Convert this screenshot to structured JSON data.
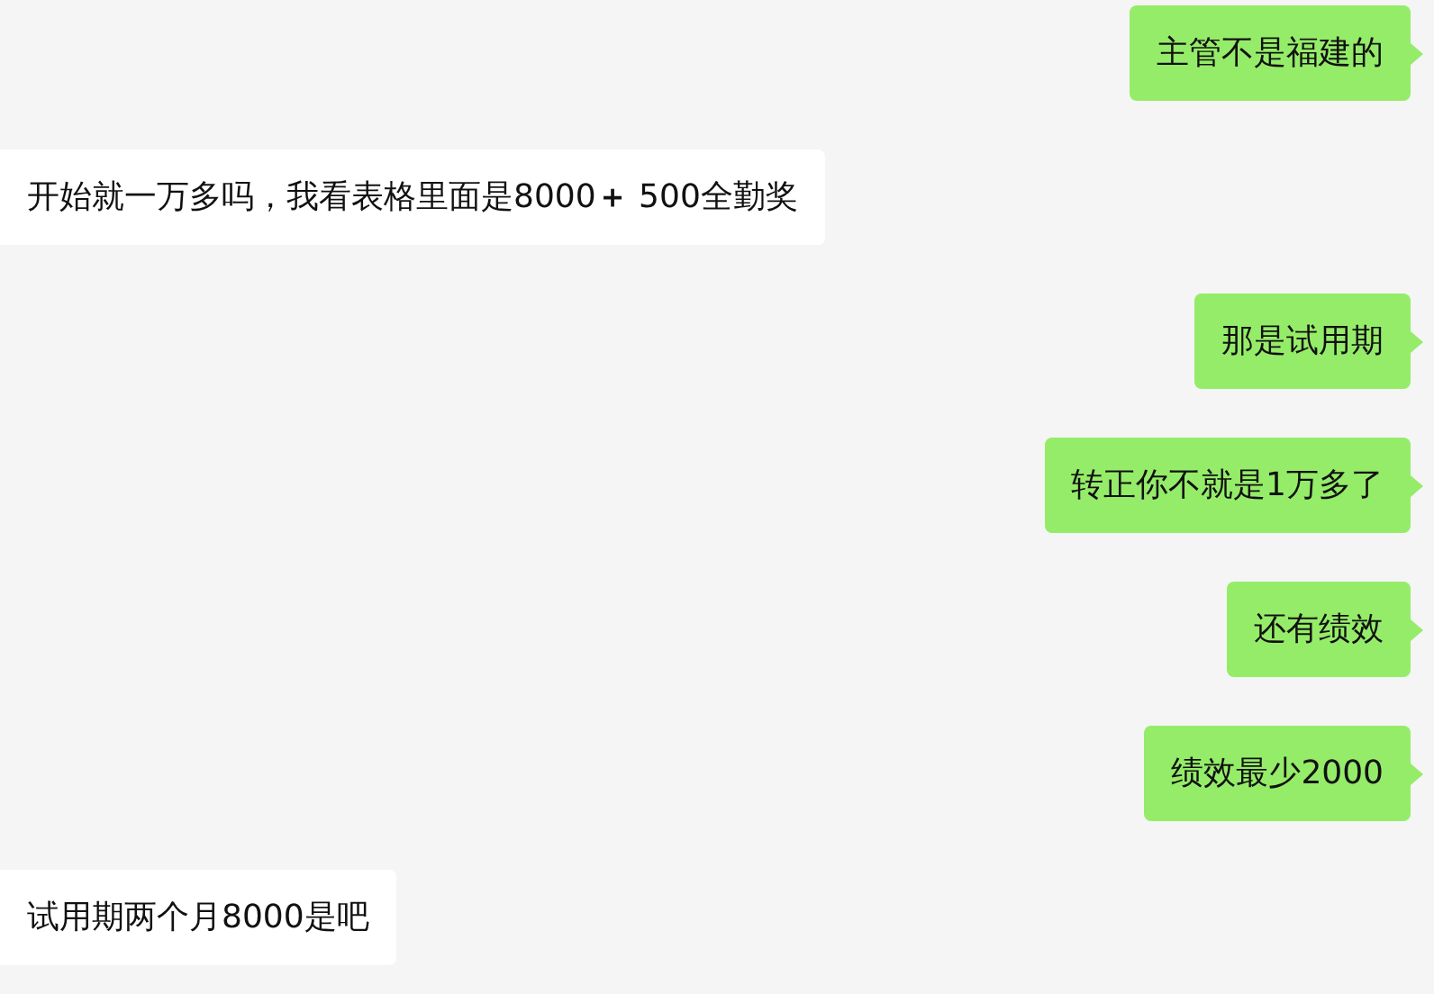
{
  "messages": [
    {
      "kind": "sent",
      "text": "主管不是福建的"
    },
    {
      "kind": "received",
      "text": "开始就一万多吗，我看表格里面是8000**＋** 500全勤奖"
    },
    {
      "kind": "sent",
      "text": "那是试用期"
    },
    {
      "kind": "sent",
      "text": "转正你不就是1万多了"
    },
    {
      "kind": "sent",
      "text": "还有绩效"
    },
    {
      "kind": "sent",
      "text": "绩效最少2000"
    },
    {
      "kind": "received",
      "text": "试用期两个月8000是吧"
    }
  ]
}
